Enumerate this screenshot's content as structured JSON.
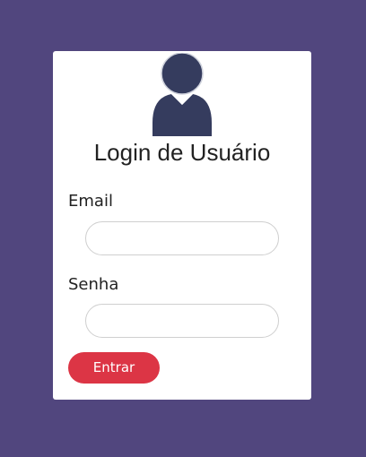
{
  "colors": {
    "background": "#51467e",
    "card": "#ffffff",
    "avatar": "#353c5e",
    "button": "#dc3545"
  },
  "avatar": {
    "icon": "user-avatar-icon"
  },
  "login": {
    "title": "Login de Usuário",
    "email_label": "Email",
    "email_value": "",
    "password_label": "Senha",
    "password_value": "",
    "submit_label": "Entrar"
  }
}
